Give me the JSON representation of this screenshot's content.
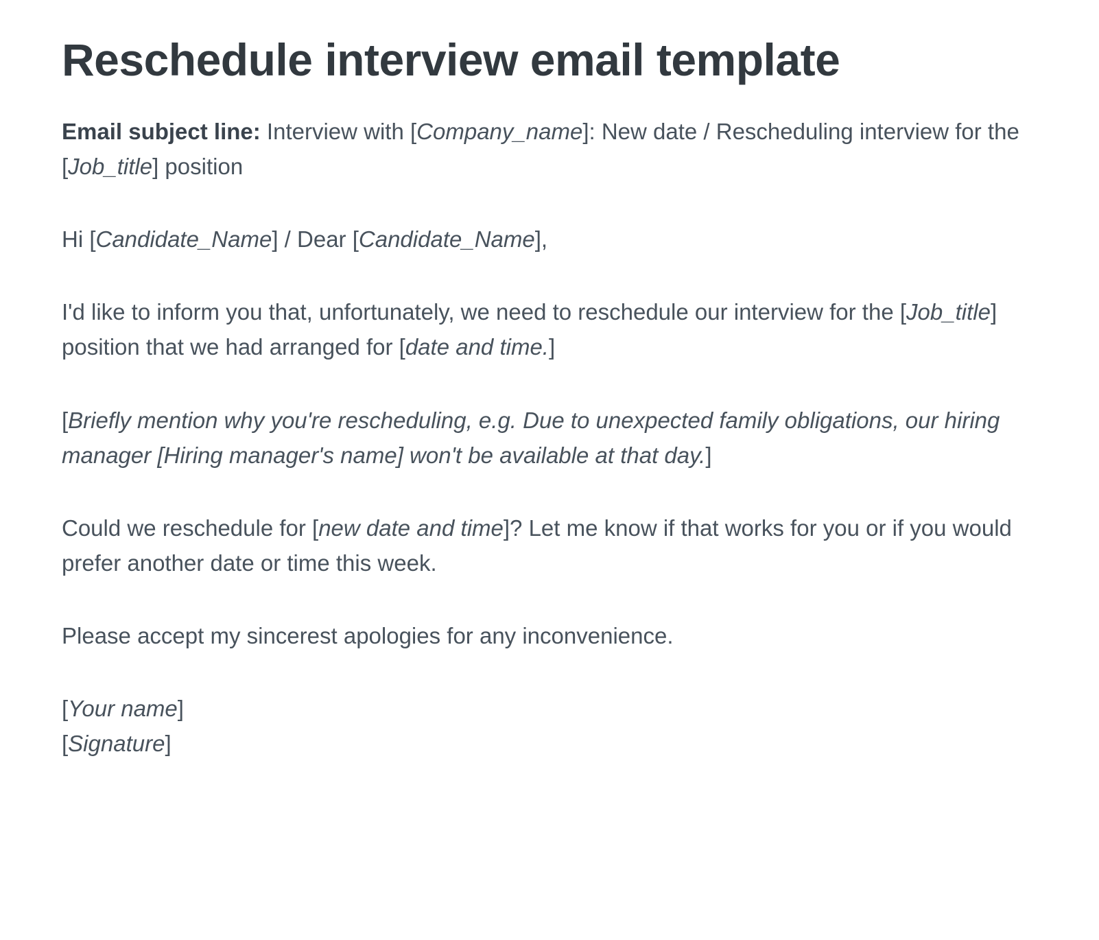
{
  "heading": "Reschedule interview email template",
  "subject": {
    "label": "Email subject line:",
    "pre": " Interview with [",
    "ph1": "Company_name",
    "mid": "]: New date / Rescheduling interview for the [",
    "ph2": "Job_title",
    "post": "] position"
  },
  "greeting": {
    "pre": "Hi [",
    "ph1": "Candidate_Name",
    "mid": "] / Dear [",
    "ph2": "Candidate_Name",
    "post": "],"
  },
  "para1": {
    "pre": "I'd like to inform you that, unfortunately, we need to reschedule our interview for the [",
    "ph1": "Job_title",
    "mid": "] position that we had arranged for [",
    "ph2": "date and time.",
    "post": "]"
  },
  "para2": {
    "pre": "[",
    "ph1": "Briefly mention why you're rescheduling, e.g. Due to unexpected family obligations, our hiring manager [Hiring manager's name] won't be available at that day.",
    "post": "]"
  },
  "para3": {
    "pre": "Could we reschedule for [",
    "ph1": "new date and time",
    "post": "]? Let me know if that works for you or if you would prefer another date or time this week."
  },
  "para4": "Please accept my sincerest apologies for any inconvenience.",
  "signoff": {
    "line1pre": "[",
    "line1ph": "Your name",
    "line1post": "]",
    "line2pre": "[",
    "line2ph": "Signature",
    "line2post": "]"
  }
}
